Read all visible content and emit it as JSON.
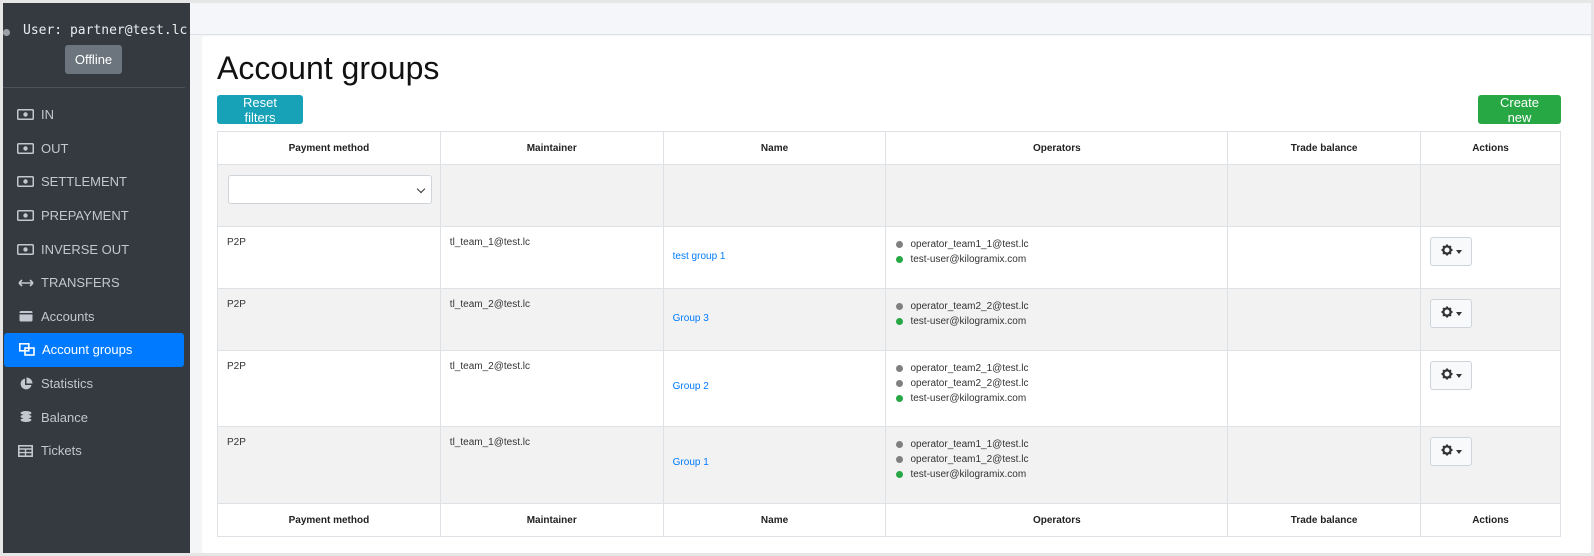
{
  "sidebar": {
    "user_label": "User: partner@test.lc",
    "status_label": "Offline",
    "items": [
      {
        "label": "IN",
        "icon": "money-icon",
        "active": false
      },
      {
        "label": "OUT",
        "icon": "money-icon",
        "active": false
      },
      {
        "label": "SETTLEMENT",
        "icon": "money-icon",
        "active": false
      },
      {
        "label": "PREPAYMENT",
        "icon": "money-icon",
        "active": false
      },
      {
        "label": "INVERSE OUT",
        "icon": "money-icon",
        "active": false
      },
      {
        "label": "TRANSFERS",
        "icon": "arrows-horizontal-icon",
        "active": false
      },
      {
        "label": "Accounts",
        "icon": "wallet-icon",
        "active": false
      },
      {
        "label": "Account groups",
        "icon": "object-group-icon",
        "active": true
      },
      {
        "label": "Statistics",
        "icon": "pie-chart-icon",
        "active": false
      },
      {
        "label": "Balance",
        "icon": "coins-icon",
        "active": false
      },
      {
        "label": "Tickets",
        "icon": "table-icon",
        "active": false
      }
    ]
  },
  "main": {
    "title": "Account groups",
    "reset_label": "Reset filters",
    "create_label": "Create new"
  },
  "table": {
    "headers": [
      "Payment method",
      "Maintainer",
      "Name",
      "Operators",
      "Trade balance",
      "Actions"
    ],
    "rows": [
      {
        "payment_method": "P2P",
        "maintainer": "tl_team_1@test.lc",
        "name": "test group 1",
        "operators": [
          {
            "email": "operator_team1_1@test.lc",
            "status": "offline"
          },
          {
            "email": "test-user@kilogramix.com",
            "status": "online"
          }
        ],
        "trade_balance": ""
      },
      {
        "payment_method": "P2P",
        "maintainer": "tl_team_2@test.lc",
        "name": "Group 3",
        "operators": [
          {
            "email": "operator_team2_2@test.lc",
            "status": "offline"
          },
          {
            "email": "test-user@kilogramix.com",
            "status": "online"
          }
        ],
        "trade_balance": ""
      },
      {
        "payment_method": "P2P",
        "maintainer": "tl_team_2@test.lc",
        "name": "Group 2",
        "operators": [
          {
            "email": "operator_team2_1@test.lc",
            "status": "offline"
          },
          {
            "email": "operator_team2_2@test.lc",
            "status": "offline"
          },
          {
            "email": "test-user@kilogramix.com",
            "status": "online"
          }
        ],
        "trade_balance": ""
      },
      {
        "payment_method": "P2P",
        "maintainer": "tl_team_1@test.lc",
        "name": "Group 1",
        "operators": [
          {
            "email": "operator_team1_1@test.lc",
            "status": "offline"
          },
          {
            "email": "operator_team1_2@test.lc",
            "status": "offline"
          },
          {
            "email": "test-user@kilogramix.com",
            "status": "online"
          }
        ],
        "trade_balance": ""
      }
    ]
  },
  "colors": {
    "sidebar_bg": "#343a40",
    "active_item": "#007bff",
    "reset_button": "#17a2b8",
    "create_button": "#28a745",
    "online_dot": "#28a745",
    "offline_dot": "#808080",
    "link": "#007bff"
  }
}
